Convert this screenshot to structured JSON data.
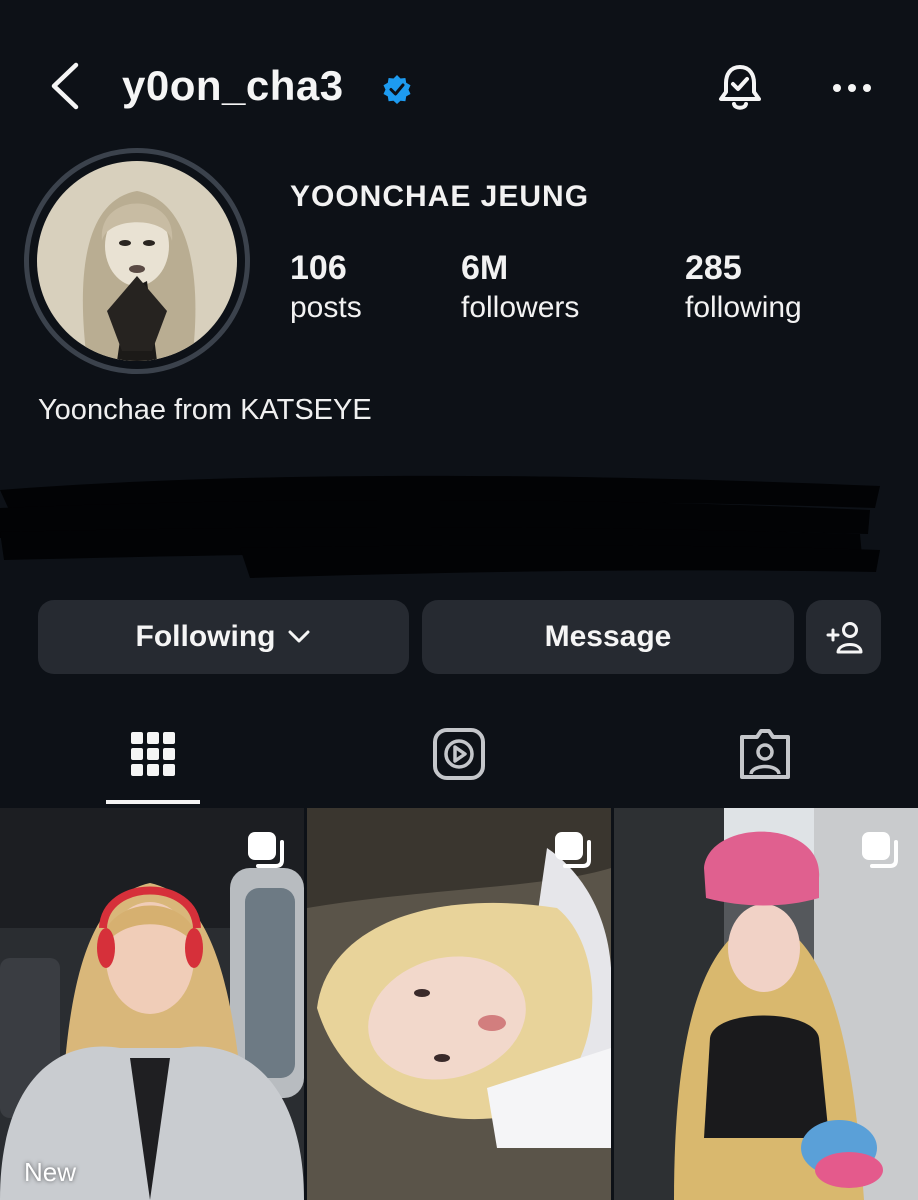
{
  "header": {
    "username": "y0on_cha3"
  },
  "profile": {
    "full_name": "YOONCHAE JEUNG",
    "stats": [
      {
        "value": "106",
        "label": "posts"
      },
      {
        "value": "6M",
        "label": "followers"
      },
      {
        "value": "285",
        "label": "following"
      }
    ],
    "bio": "Yoonchae from KATSEYE"
  },
  "actions": {
    "following_label": "Following",
    "message_label": "Message"
  },
  "tabs": [
    {
      "icon": "grid-icon",
      "selected": true
    },
    {
      "icon": "reels-icon",
      "selected": false
    },
    {
      "icon": "tagged-icon",
      "selected": false
    }
  ],
  "posts": [
    {
      "badge": "New",
      "multi": true
    },
    {
      "multi": true
    },
    {
      "multi": true
    }
  ],
  "colors": {
    "background": "#0d1117",
    "button_bg": "#262a31",
    "verified_blue": "#1d9bf0"
  }
}
